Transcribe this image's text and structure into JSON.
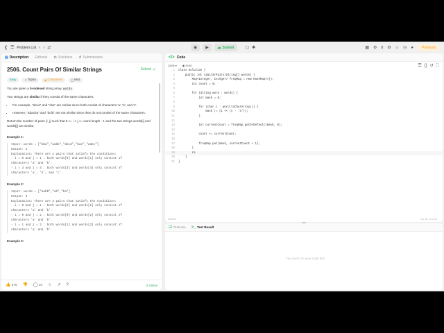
{
  "navbar": {
    "problem_list": "Problem List",
    "submit_label": "Submit",
    "streak_count": "0",
    "premium_label": "Premium"
  },
  "left_tabs": [
    "Description",
    "Editorial",
    "Solutions",
    "Submissions"
  ],
  "problem": {
    "title": "2506. Count Pairs Of Similar Strings",
    "status": "Solved",
    "difficulty": "Easy",
    "topics": "Topics",
    "companies": "Companies",
    "hint": "Hint",
    "intro_1": "You are given a",
    "intro_bold": "0-indexed",
    "intro_2": "string array",
    "intro_code": "words",
    "intro_end": ".",
    "similar_1": "Two strings are",
    "similar_bold": "similar",
    "similar_2": "if they consist of the same characters.",
    "bullet_1": "For example, \"abca\" and \"cba\" are similar since both consist of characters 'a', 'b', and 'c'.",
    "bullet_2": "However, \"abacba\" and \"bcfd\" are not similar since they do not consist of the same characters.",
    "task": "Return the number of pairs (i, j) such that 0 <= i < j <= word.length - 1 and the two strings words[i] and words[j] are similar.",
    "example_1_heading": "Example 1:",
    "example_1": "Input: words = [\"aba\",\"aabb\",\"abcd\",\"bac\",\"aabc\"]\nOutput: 2\nExplanation: There are 2 pairs that satisfy the conditions:\n- i = 0 and j = 1 : both words[0] and words[1] only consist of\ncharacters 'a' and 'b'.\n- i = 3 and j = 4 : both words[3] and words[4] only consist of\ncharacters 'a', 'b', and 'c'.",
    "example_2_heading": "Example 2:",
    "example_2": "Input: words = [\"aabb\",\"ab\",\"ba\"]\nOutput: 3\nExplanation: There are 3 pairs that satisfy the conditions:\n- i = 0 and j = 1 : both words[0] and words[1] only consist of\ncharacters 'a' and 'b'.\n- i = 0 and j = 2 : both words[0] and words[2] only consist of\ncharacters 'a' and 'b'.\n- i = 1 and j = 2 : both words[1] and words[2] only consist of\ncharacters 'a' and 'b'.",
    "example_3_heading": "Example 3:"
  },
  "footer": {
    "likes": "576",
    "comments": "20",
    "online": "8 Online"
  },
  "code": {
    "tab_label": "Code",
    "language": "Java",
    "mode": "Auto",
    "lines": [
      "class Solution {",
      "    public int similarPairs(String[] words) {",
      "        Map<Integer, Integer> freqMap = new HashMap<>();",
      "        int count = 0;",
      "",
      "        for (String word : words) {",
      "            int mask = 0;",
      "",
      "            for (char c : word.toCharArray()) {",
      "                mask |= (1 << (c - 'a'));",
      "            }",
      "",
      "            int currentCount = freqMap.getOrDefault(mask, 0);",
      "",
      "            count += currentCount;",
      "",
      "            freqMap.put(mask, currentCount + 1);",
      "        }",
      "        re",
      "    }",
      "}"
    ],
    "saved_label": "Saved",
    "cursor": "Ln 19, Col 11"
  },
  "results": {
    "testcase_tab": "Testcase",
    "result_tab": "Test Result",
    "message": "You must run your code first"
  }
}
